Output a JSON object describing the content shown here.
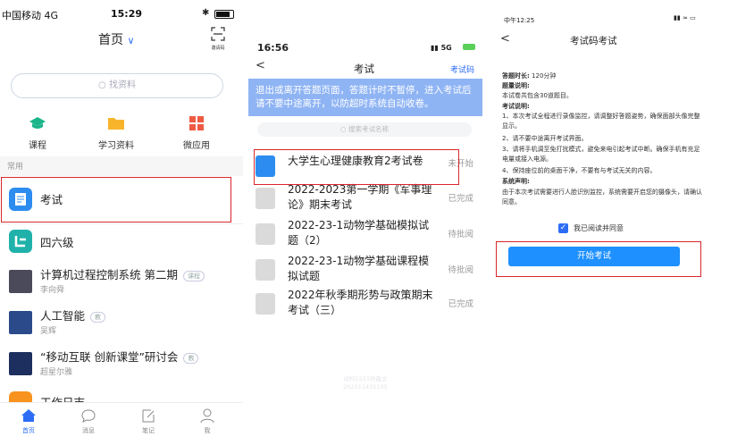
{
  "left_app": {
    "status": {
      "carrier": "中国移动 4G",
      "time": "15:29"
    },
    "header": {
      "title": "首页",
      "scan_label": "邀请码"
    },
    "search": {
      "placeholder": "找资料"
    },
    "quick": [
      {
        "label": "课程"
      },
      {
        "label": "学习资料"
      },
      {
        "label": "微应用"
      }
    ],
    "section_label": "常用",
    "list": [
      {
        "title": "考试",
        "sub": ""
      },
      {
        "title": "四六级",
        "sub": ""
      },
      {
        "title": "计算机过程控制系统 第二期",
        "tag": "课程",
        "sub": "李向舜"
      },
      {
        "title": "人工智能",
        "tag": "教",
        "sub": "吴辉"
      },
      {
        "title": "“移动互联 创新课堂”研讨会",
        "tag": "教",
        "sub": "超星尔雅"
      },
      {
        "title": "工作日志",
        "sub": ""
      }
    ],
    "tabs": [
      {
        "label": "首页"
      },
      {
        "label": "消息"
      },
      {
        "label": "笔记"
      },
      {
        "label": "我"
      }
    ]
  },
  "middle_app": {
    "status": {
      "time": "16:56",
      "network": "5G"
    },
    "header": {
      "title": "考试",
      "action": "考试码"
    },
    "notice": "退出或离开答题页面，答题计时不暂停，进入考试后请不要中途离开，以防超时系统自动收卷。",
    "search": {
      "placeholder": "搜索考试名称"
    },
    "exams": [
      {
        "title": "大学生心理健康教育2考试卷",
        "status": "未开始"
      },
      {
        "title": "2022-2023第一学期《军事理论》期末考试",
        "status": "已完成"
      },
      {
        "title": "2022-23-1动物学基础模拟试题（2）",
        "status": "待批阅"
      },
      {
        "title": "2022-23-1动物学基础课程模拟试题",
        "status": "待批阅"
      },
      {
        "title": "2022年秋季期形势与政策期末考试（三）",
        "status": "已完成"
      }
    ],
    "watermark": {
      "line1": "动科1221孙鑫文",
      "line2": "202211431105"
    }
  },
  "right_app": {
    "status": {
      "time": "中午12:25"
    },
    "header": {
      "title": "考试码考试"
    },
    "info": {
      "duration_label": "答题时长:",
      "duration": "120分钟",
      "quota_label": "题量说明:",
      "quota": "本试卷共包含30道题目。",
      "rules_label": "考试说明:",
      "rules": [
        "1、本次考试全程进行录像监控，请调整好答题姿势，确保面部头像完整显示。",
        "2、请不要中途离开考试界面。",
        "3、请将手机调至免打扰模式，避免来电引起考试中断。确保手机有充足电量或接入电源。",
        "4、保持座位前的桌面干净，不要有与考试无关的内容。"
      ],
      "system_label": "系统声明:",
      "system": "由于本次考试需要进行人脸识别监控，系统需要开启您的摄像头，请确认同意。"
    },
    "agree": "我已阅读并同意",
    "start_button": "开始考试"
  },
  "colors": {
    "accent": "#2d6df6",
    "notice_bg": "#8fb4f4",
    "highlight": "#d9262b",
    "button": "#1e90ff"
  }
}
